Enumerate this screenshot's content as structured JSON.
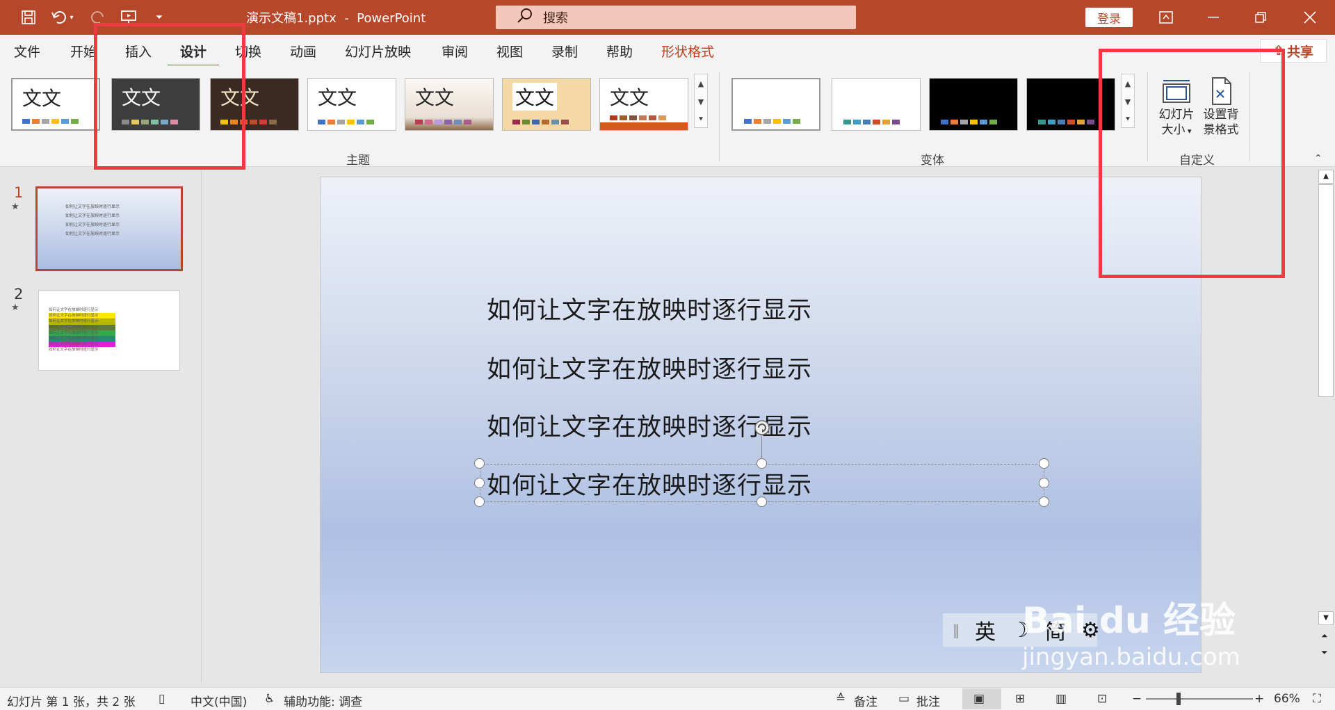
{
  "app": {
    "doc_title": "演示文稿1.pptx",
    "app_name": "PowerPoint",
    "separator": "-",
    "search_placeholder": "搜索",
    "login": "登录",
    "share": "共享"
  },
  "tabs": [
    "文件",
    "开始",
    "插入",
    "设计",
    "切换",
    "动画",
    "幻灯片放映",
    "审阅",
    "视图",
    "录制",
    "帮助",
    "形状格式"
  ],
  "active_tab": "设计",
  "ribbon": {
    "themes_group": "主题",
    "variants_group": "变体",
    "custom_group": "自定义",
    "theme_sample": "文文",
    "slide_size_label": "幻灯片\n大小",
    "slide_size_l1": "幻灯片",
    "slide_size_l2": "大小",
    "bg_format_l1": "设置背",
    "bg_format_l2": "景格式"
  },
  "slides_pane": {
    "numbers": [
      "1",
      "2"
    ],
    "thumb_text": "如何让文字在放映时逐行显示"
  },
  "slide": {
    "lines": [
      "如何让文字在放映时逐行显示",
      "如何让文字在放映时逐行显示",
      "如何让文字在放映时逐行显示",
      "如何让文字在放映时逐行显示"
    ]
  },
  "ime": {
    "mode": "英",
    "moon": "☽",
    "simp": "简",
    "gear": "⚙"
  },
  "watermark": {
    "brand": "Bai du 经验",
    "url": "jingyan.baidu.com"
  },
  "status": {
    "slide_info": "幻灯片 第 1 张，共 2 张",
    "language": "中文(中国)",
    "accessibility": "辅助功能: 调查",
    "notes": "备注",
    "comments": "批注",
    "zoom": "66%"
  },
  "colors": {
    "accent": "#b7472a",
    "highlight_box": "#ee3b42"
  }
}
